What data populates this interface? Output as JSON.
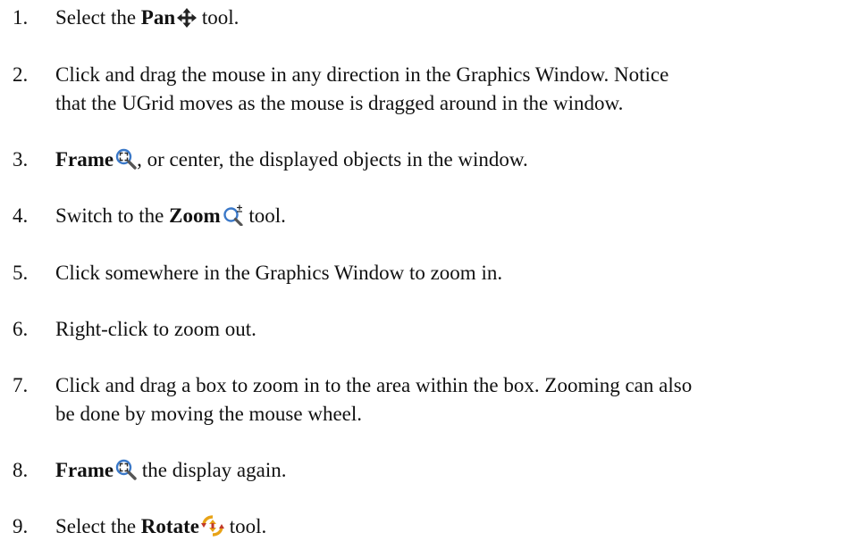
{
  "steps": [
    {
      "number": "1.",
      "pre": "Select the ",
      "bold": "Pan",
      "icon": "pan-icon",
      "post": " tool."
    },
    {
      "number": "2.",
      "line1": "Click and drag the mouse in any direction in the Graphics Window. Notice",
      "line2": "that the UGrid moves as the mouse is dragged around in the window."
    },
    {
      "number": "3.",
      "bold": "Frame",
      "icon": "frame-icon",
      "post": ", or center, the displayed objects in the window."
    },
    {
      "number": "4.",
      "pre": "Switch to the ",
      "bold": "Zoom",
      "icon": "zoom-icon",
      "post": " tool."
    },
    {
      "number": "5.",
      "text": "Click somewhere in the Graphics Window to zoom in."
    },
    {
      "number": "6.",
      "text": "Right-click to zoom out."
    },
    {
      "number": "7.",
      "line1": "Click and drag a box to zoom in to the area within the box. Zooming can also",
      "line2": "be done by moving the mouse wheel."
    },
    {
      "number": "8.",
      "bold": "Frame",
      "icon": "frame-icon",
      "post": " the display again."
    },
    {
      "number": "9.",
      "pre": "Select the ",
      "bold": "Rotate",
      "icon": "rotate-icon",
      "post": " tool."
    }
  ],
  "colors": {
    "text": "#111111",
    "icon_blue": "#3a78c8",
    "icon_dark": "#222222",
    "rotate_orange": "#e8a317",
    "rotate_red": "#c0392b"
  }
}
